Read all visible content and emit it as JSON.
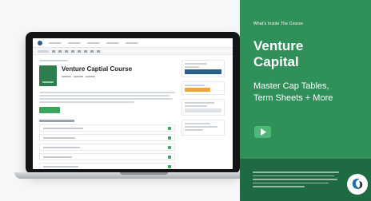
{
  "course_page": {
    "title": "Venture Captial Course"
  },
  "promo": {
    "eyebrow": "What's Inside The Course",
    "headline_line1": "Venture",
    "headline_line2": "Capital",
    "subhead_line1": "Master Cap Tables,",
    "subhead_line2": "Term Sheets + More"
  },
  "colors": {
    "promo_green": "#30905a",
    "footer_green": "#1e6a42",
    "play_green": "#4eb876",
    "enroll_green": "#3aa65a",
    "brand_blue": "#2b5d8c"
  },
  "icons": {
    "play": "play-icon",
    "brand": "brand-logo-icon"
  }
}
